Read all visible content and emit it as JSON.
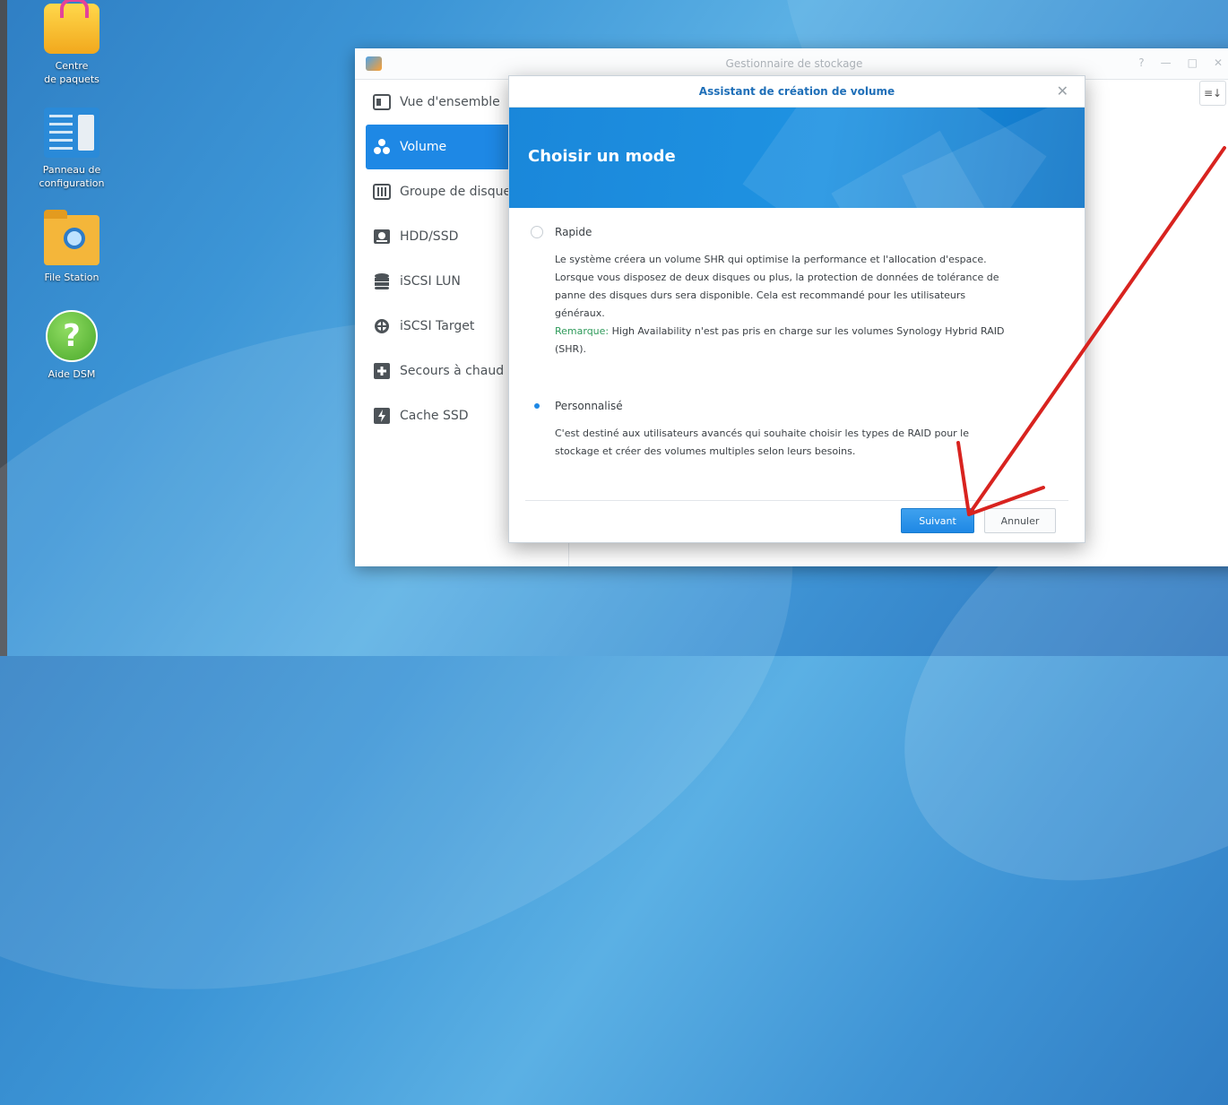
{
  "desktop": {
    "icons": [
      {
        "label_line1": "Centre",
        "label_line2": "de paquets"
      },
      {
        "label_line1": "Panneau de",
        "label_line2": "configuration"
      },
      {
        "label_line1": "File Station",
        "label_line2": ""
      },
      {
        "label_line1": "Aide DSM",
        "label_line2": ""
      }
    ]
  },
  "window": {
    "title": "Gestionnaire de stockage",
    "controls": [
      "?",
      "—",
      "□",
      "✕"
    ],
    "sort_label": "≡↓",
    "sidebar": [
      {
        "label": "Vue d'ensemble",
        "icon": "overview-icon"
      },
      {
        "label": "Volume",
        "icon": "volume-icon"
      },
      {
        "label": "Groupe de disques",
        "icon": "disk-group-icon"
      },
      {
        "label": "HDD/SSD",
        "icon": "hdd-icon"
      },
      {
        "label": "iSCSI LUN",
        "icon": "lun-icon"
      },
      {
        "label": "iSCSI Target",
        "icon": "target-icon"
      },
      {
        "label": "Secours à chaud",
        "icon": "hot-spare-icon"
      },
      {
        "label": "Cache SSD",
        "icon": "ssd-cache-icon"
      }
    ]
  },
  "dialog": {
    "title": "Assistant de création de volume",
    "close": "✕",
    "heading": "Choisir un mode",
    "option_quick": {
      "label": "Rapide",
      "selected": false,
      "desc_l1": "Le système créera un volume SHR qui optimise la performance et l'allocation d'espace.",
      "desc_l2": "Lorsque vous disposez de deux disques ou plus, la protection de données de tolérance de",
      "desc_l3": "panne des disques durs sera disponible. Cela est recommandé pour les utilisateurs",
      "desc_l4": "généraux.",
      "remark_label": "Remarque:",
      "remark_text": " High Availability n'est pas pris en charge sur les volumes Synology Hybrid RAID",
      "remark_l2": "(SHR)."
    },
    "option_custom": {
      "label": "Personnalisé",
      "selected": true,
      "desc_l1": "C'est destiné aux utilisateurs avancés qui souhaite choisir les types de RAID pour le",
      "desc_l2": "stockage et créer des volumes multiples selon leurs besoins."
    },
    "next_label": "Suivant",
    "cancel_label": "Annuler"
  },
  "colors": {
    "accent": "#1e88e5",
    "remark": "#2e9a5a",
    "annotation": "#d8231f"
  }
}
